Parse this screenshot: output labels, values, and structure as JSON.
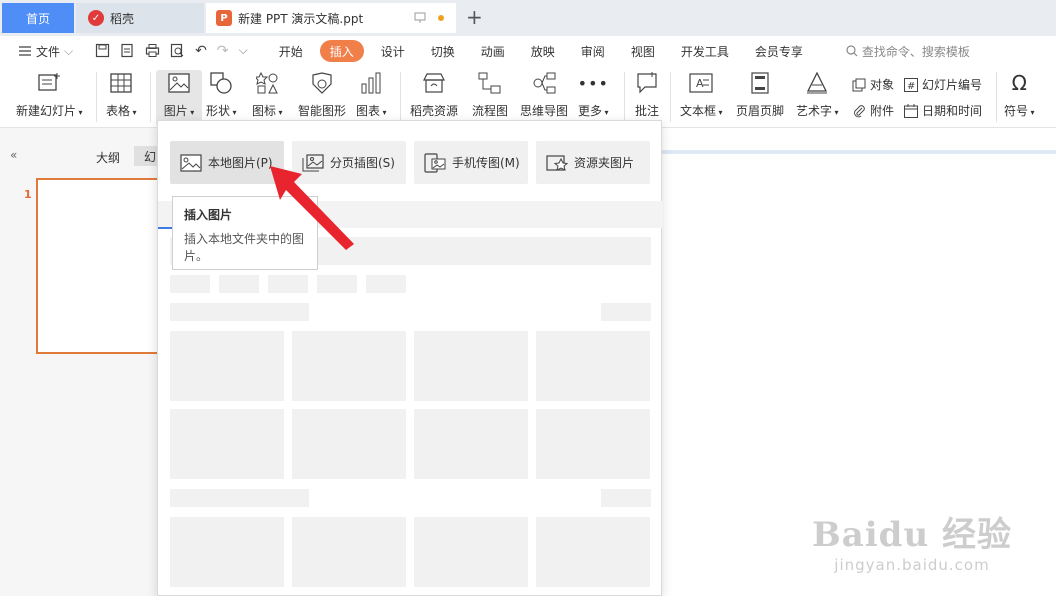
{
  "tabs": {
    "home": "首页",
    "daoke": "稻壳",
    "doc": "新建 PPT 演示文稿.ppt"
  },
  "menu": {
    "file": "文件",
    "tabs": [
      "开始",
      "插入",
      "设计",
      "切换",
      "动画",
      "放映",
      "审阅",
      "视图",
      "开发工具",
      "会员专享"
    ],
    "active_tab": "插入",
    "search": "查找命令、搜索模板"
  },
  "ribbon": {
    "new_slide": "新建幻灯片",
    "table": "表格",
    "picture": "图片",
    "shape": "形状",
    "icon": "图标",
    "smart_shape": "智能图形",
    "chart": "图表",
    "daoke_res": "稻壳资源",
    "flowchart": "流程图",
    "mindmap": "思维导图",
    "more": "更多",
    "comment": "批注",
    "textbox": "文本框",
    "header_footer": "页眉页脚",
    "wordart": "艺术字",
    "object": "对象",
    "slide_number": "幻灯片编号",
    "attachment": "附件",
    "datetime": "日期和时间",
    "symbol": "符号"
  },
  "left_panel": {
    "outline": "大纲",
    "slides": "幻",
    "slide_number": "1"
  },
  "dropdown": {
    "options": [
      "本地图片(P)",
      "分页插图(S)",
      "手机传图(M)",
      "资源夹图片"
    ]
  },
  "tooltip": {
    "title": "插入图片",
    "desc": "插入本地文件夹中的图片。"
  },
  "watermark": {
    "main": "Baidu 经验",
    "sub": "jingyan.baidu.com"
  },
  "colors": {
    "accent": "#f07f4a",
    "tab_active": "#4f8ef7",
    "arrow": "#e8252e"
  }
}
